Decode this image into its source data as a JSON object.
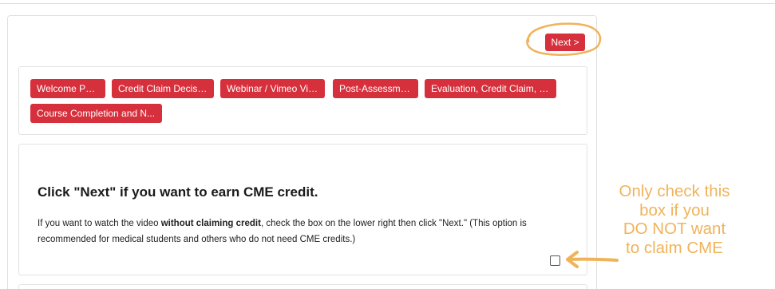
{
  "header": {
    "next_label": "Next >"
  },
  "nav": {
    "items": [
      "Welcome Page",
      "Credit Claim Decision",
      "Webinar / Vimeo Video",
      "Post-Assessment",
      "Evaluation, Credit Claim, a...",
      "Course Completion and N..."
    ]
  },
  "content": {
    "heading": "Click \"Next\" if you want to earn CME credit.",
    "desc_prefix": "If you want to watch the video ",
    "desc_bold": "without claiming credit",
    "desc_suffix": ", check the box on the lower right then click \"Next.\" (This option is recommended for medical students and others who do not need CME credits.)",
    "checkbox_checked": false
  },
  "annotation": {
    "lines": [
      "Only check this",
      "box if you",
      "DO NOT want",
      "to claim CME"
    ],
    "color": "#f0b35a"
  },
  "colors": {
    "accent": "#d6303d",
    "highlight": "#f0b35a"
  }
}
